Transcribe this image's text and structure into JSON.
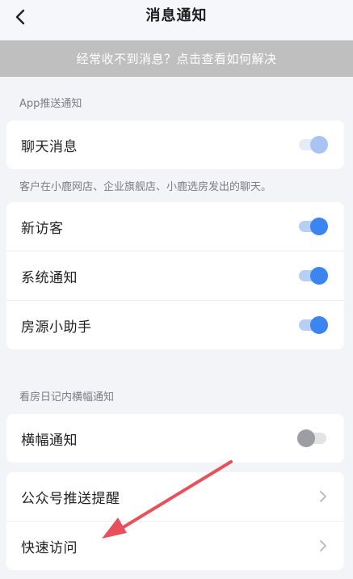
{
  "header": {
    "title": "消息通知"
  },
  "banner": {
    "text": "经常收不到消息？点击查看如何解决"
  },
  "app_push": {
    "section_label": "App推送通知",
    "chat": {
      "label": "聊天消息",
      "enabled": true
    },
    "chat_description": "客户在小鹿网店、企业旗舰店、小鹿选房发出的聊天。",
    "items": [
      {
        "label": "新访客",
        "enabled": true
      },
      {
        "label": "系统通知",
        "enabled": true
      },
      {
        "label": "房源小助手",
        "enabled": true
      }
    ]
  },
  "banner_notify": {
    "section_label": "看房日记内横幅通知",
    "item": {
      "label": "横幅通知",
      "enabled": false
    }
  },
  "links": [
    {
      "label": "公众号推送提醒"
    },
    {
      "label": "快速访问"
    }
  ],
  "colors": {
    "toggle_on": "#3a85f0",
    "annotation_arrow": "#e8505b"
  }
}
